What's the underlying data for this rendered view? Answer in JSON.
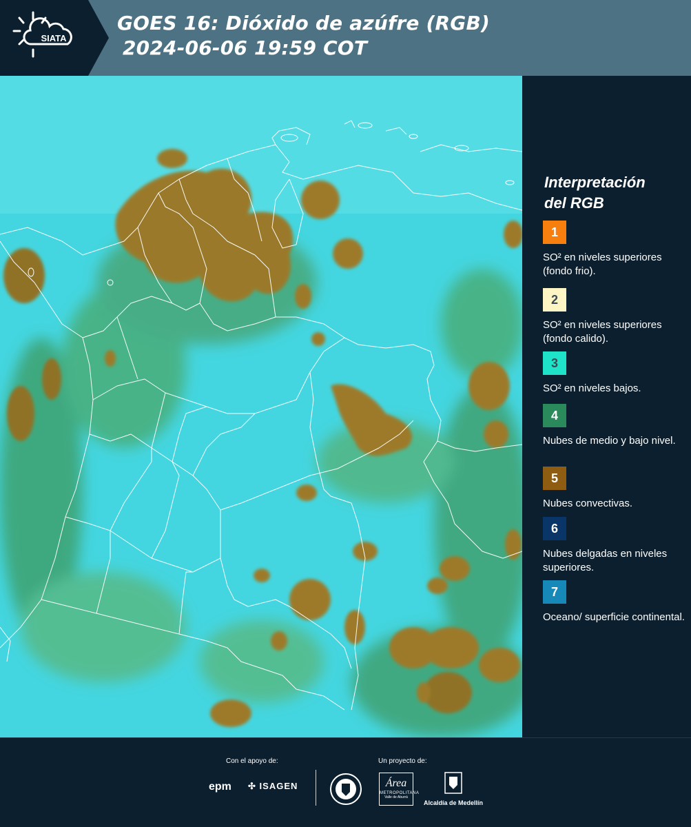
{
  "header": {
    "logo_text": "SIATA",
    "title_line1": "GOES 16: Dióxido de azúfre (RGB)",
    "title_line2": "2024-06-06 19:59 COT"
  },
  "legend": {
    "title_line1": "Interpretación",
    "title_line2": "del RGB",
    "items": [
      {
        "number": "1",
        "label": "SO² en niveles superiores (fondo frio).",
        "color": "#f77f0e"
      },
      {
        "number": "2",
        "label": "SO² en niveles superiores (fondo calido).",
        "color": "#fdf5c4"
      },
      {
        "number": "3",
        "label": "SO² en niveles bajos.",
        "color": "#1fe3c8"
      },
      {
        "number": "4",
        "label": "Nubes de medio y bajo nivel.",
        "color": "#2b8a5c"
      },
      {
        "number": "5",
        "label": "Nubes convectivas.",
        "color": "#8f5d12"
      },
      {
        "number": "6",
        "label": "Nubes delgadas en niveles superiores.",
        "color": "#0a3568"
      },
      {
        "number": "7",
        "label": "Oceano/ superficie continental.",
        "color": "#1689b8"
      }
    ]
  },
  "footer": {
    "support_label": "Con el apoyo de:",
    "project_label": "Un proyecto de:",
    "logo_epm": "epm",
    "logo_isagen": "ISAGEN",
    "logo_area_line1": "Área",
    "logo_area_line2": "METROPOLITANA",
    "logo_area_line3": "Valle de Aburrá",
    "logo_alcaldia": "Alcaldía de Medellín"
  },
  "colors": {
    "header_bg": "#4d7283",
    "panel_bg": "#0b1f2e",
    "map_base": "#3ed3df",
    "convective": "#8f6a1c"
  }
}
